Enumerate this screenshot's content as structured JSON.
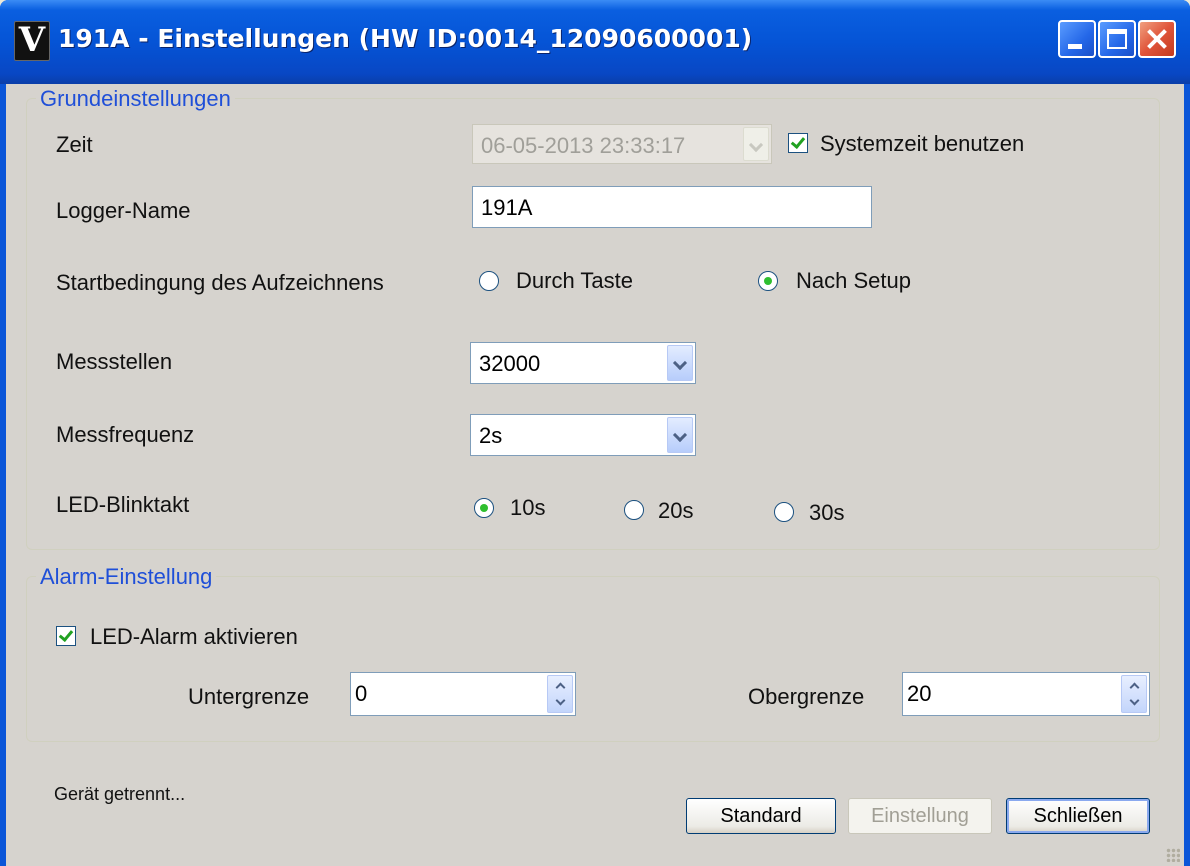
{
  "window": {
    "title": "191A - Einstellungen (HW ID:0014_12090600001)",
    "icon_glyph": "V",
    "controls": [
      "minimize-icon",
      "maximize-icon",
      "close-icon"
    ]
  },
  "grundeinstellungen": {
    "title": "Grundeinstellungen",
    "zeit": {
      "label": "Zeit",
      "value": "06-05-2013 23:33:17",
      "enabled": false,
      "systemzeit_label": "Systemzeit benutzen",
      "systemzeit_checked": true
    },
    "logger_name": {
      "label": "Logger-Name",
      "value": "191A"
    },
    "startbedingung": {
      "label": "Startbedingung des Aufzeichnens",
      "options": [
        "Durch Taste",
        "Nach Setup"
      ],
      "selected": "Nach Setup"
    },
    "messstellen": {
      "label": "Messstellen",
      "value": "32000"
    },
    "messfrequenz": {
      "label": "Messfrequenz",
      "value": "2s"
    },
    "led_blinktakt": {
      "label": "LED-Blinktakt",
      "options": [
        "10s",
        "20s",
        "30s"
      ],
      "selected": "10s"
    }
  },
  "alarm": {
    "title": "Alarm-Einstellung",
    "led_alarm_label": "LED-Alarm aktivieren",
    "led_alarm_checked": true,
    "untergrenze_label": "Untergrenze",
    "untergrenze_value": "0",
    "obergrenze_label": "Obergrenze",
    "obergrenze_value": "20"
  },
  "status": "Gerät getrennt...",
  "buttons": {
    "standard": "Standard",
    "einstellung": "Einstellung",
    "schliessen": "Schließen"
  },
  "colors": {
    "title_bar": "#0554d6",
    "dialog_bg": "#d6d3ce",
    "group_title": "#1f4fd8",
    "close_button": "#e0553a"
  }
}
